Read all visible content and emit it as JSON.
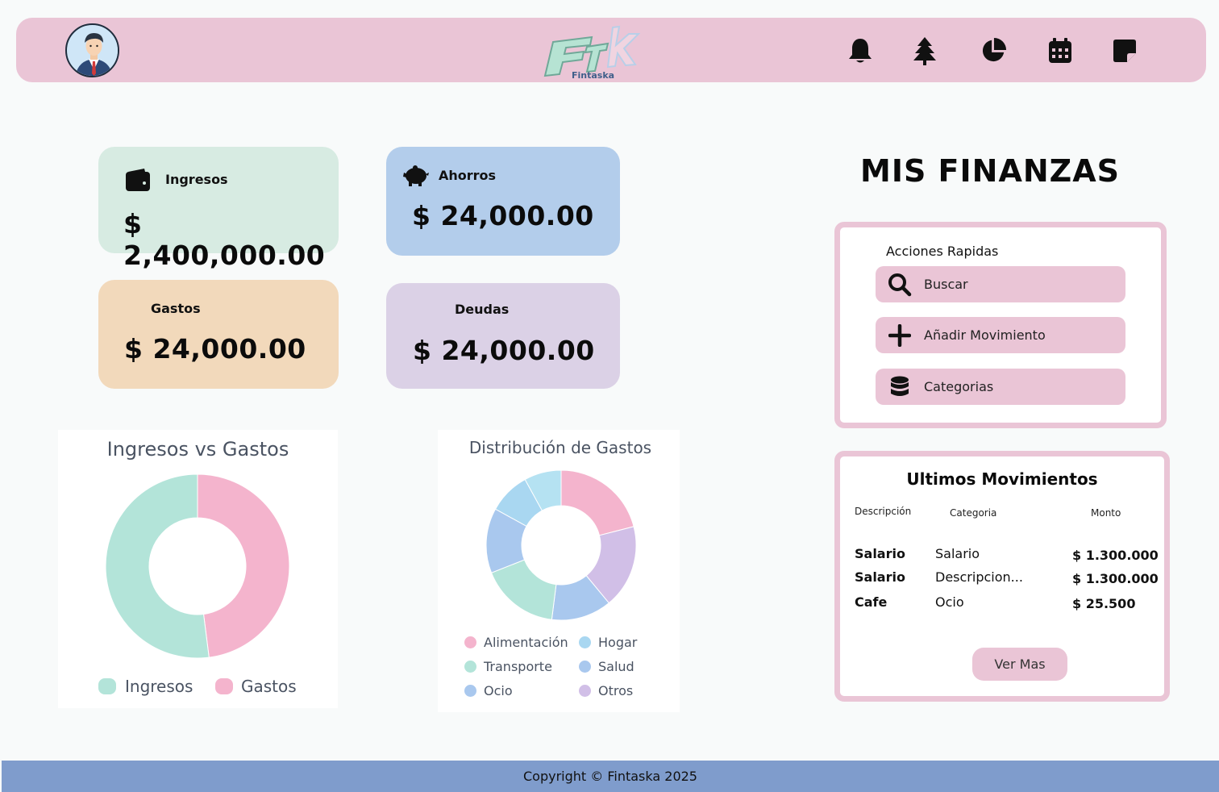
{
  "header": {
    "logo_text": "Ftk",
    "logo_subtext": "Fintaska",
    "nav": [
      {
        "icon": "bell-icon"
      },
      {
        "icon": "tree-icon"
      },
      {
        "icon": "pie-chart-icon"
      },
      {
        "icon": "calendar-icon"
      },
      {
        "icon": "sticky-note-icon"
      }
    ]
  },
  "cards": {
    "ingresos": {
      "label": "Ingresos",
      "value": "$ 2,400,000.00",
      "color": "#d7ebe2",
      "icon": "wallet-icon"
    },
    "ahorros": {
      "label": "Ahorros",
      "value": "$ 24,000.00",
      "color": "#b3cdeb",
      "icon": "piggy-bank-icon"
    },
    "gastos": {
      "label": "Gastos",
      "value": "$ 24,000.00",
      "color": "#f2d9bb"
    },
    "deudas": {
      "label": "Deudas",
      "value": "$ 24,000.00",
      "color": "#dbd1e6"
    }
  },
  "chart_data": [
    {
      "type": "pie",
      "title": "Ingresos vs Gastos",
      "donut": true,
      "categories": [
        "Ingresos",
        "Gastos"
      ],
      "values": [
        52,
        48
      ],
      "colors": [
        "#b3e4d9",
        "#f4b4cd"
      ],
      "legend": "bottom"
    },
    {
      "type": "pie",
      "title": "Distribución de Gastos",
      "donut": true,
      "categories": [
        "Alimentación",
        "Hogar",
        "Transporte",
        "Salud",
        "Ocio",
        "Otros"
      ],
      "slices": [
        {
          "label": "Alimentación",
          "value": 21,
          "color": "#f4b4cd"
        },
        {
          "label": "Otros",
          "value": 18,
          "color": "#d1bfe7"
        },
        {
          "label": "Salud",
          "value": 13,
          "color": "#a9c8ee"
        },
        {
          "label": "Transporte",
          "value": 17,
          "color": "#b3e4d9"
        },
        {
          "label": "Ocio",
          "value": 14,
          "color": "#a9c8ee"
        },
        {
          "label": "Hogar",
          "value": 9,
          "color": "#a9d7f1"
        },
        {
          "label": "Hogar",
          "value": 8,
          "color": "#b5e2f2"
        }
      ],
      "legend_entries": [
        {
          "label": "Alimentación",
          "color": "#f4b4cd"
        },
        {
          "label": "Hogar",
          "color": "#a9d7f1"
        },
        {
          "label": "Transporte",
          "color": "#b3e4d9"
        },
        {
          "label": "Salud",
          "color": "#a9c8ee"
        },
        {
          "label": "Ocio",
          "color": "#a9c8ee"
        },
        {
          "label": "Otros",
          "color": "#d1bfe7"
        }
      ],
      "legend": "bottom"
    }
  ],
  "main_title": "MIS FINANZAS",
  "quick_actions": {
    "title": "Acciones Rapidas",
    "buttons": [
      {
        "label": "Buscar",
        "icon": "search-icon"
      },
      {
        "label": "Añadir Movimiento",
        "icon": "plus-icon"
      },
      {
        "label": "Categorias",
        "icon": "database-icon"
      }
    ]
  },
  "movements": {
    "title": "Ultimos Movimientos",
    "columns": [
      "Descripción",
      "Categoria",
      "Monto"
    ],
    "rows": [
      {
        "desc": "Salario",
        "cat": "Salario",
        "amount": "$ 1.300.000"
      },
      {
        "desc": "Salario",
        "cat": "Descripcion...",
        "amount": "$ 1.300.000"
      },
      {
        "desc": "Cafe",
        "cat": "Ocio",
        "amount": "$ 25.500"
      }
    ],
    "more_label": "Ver Mas"
  },
  "footer": {
    "text": "Copyright © Fintaska 2025"
  },
  "colors": {
    "accent_pink": "#eac5d6",
    "footer_blue": "#7f9ccc"
  }
}
